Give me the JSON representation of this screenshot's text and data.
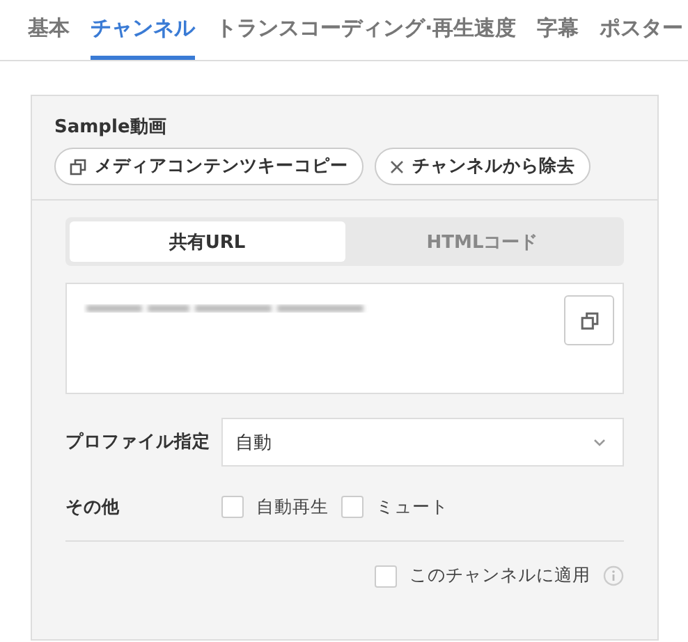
{
  "tabs": [
    {
      "label": "基本",
      "selected": false
    },
    {
      "label": "チャンネル",
      "selected": true
    },
    {
      "label": "トランスコーディング·再生速度",
      "selected": false
    },
    {
      "label": "字幕",
      "selected": false
    },
    {
      "label": "ポスター",
      "selected": false
    }
  ],
  "channel": {
    "title": "Sample動画",
    "actions": [
      {
        "kind": "copy",
        "label": "メディアコンテンツキーコピー"
      },
      {
        "kind": "remove",
        "label": "チャンネルから除去"
      }
    ],
    "share_tabs": [
      {
        "label": "共有URL",
        "selected": true
      },
      {
        "label": "HTMLコード",
        "selected": false
      }
    ],
    "profile": {
      "label": "プロファイル指定",
      "value": "自動"
    },
    "other": {
      "label": "その他",
      "options": [
        {
          "label": "自動再生",
          "checked": false
        },
        {
          "label": "ミュート",
          "checked": false
        }
      ]
    },
    "apply": {
      "label": "このチャンネルに適用",
      "checked": false
    }
  }
}
